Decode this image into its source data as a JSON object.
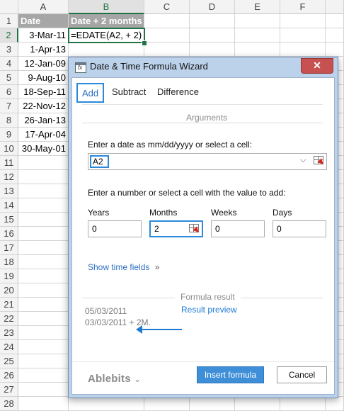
{
  "sheet": {
    "columns": [
      "A",
      "B",
      "C",
      "D",
      "E",
      "F"
    ],
    "rows": [
      "1",
      "2",
      "3",
      "4",
      "5",
      "6",
      "7",
      "8",
      "9",
      "10",
      "11",
      "12",
      "13",
      "14",
      "15",
      "16",
      "17",
      "18",
      "19",
      "20",
      "21",
      "22",
      "23",
      "24",
      "25",
      "26",
      "27",
      "28"
    ],
    "header_a": "Date",
    "header_b": "Date + 2 months",
    "dates": [
      "3-Mar-11",
      "1-Apr-13",
      "12-Jan-09",
      "9-Aug-10",
      "18-Sep-11",
      "22-Nov-12",
      "26-Jan-13",
      "17-Apr-04",
      "30-May-01"
    ],
    "formula": "=EDATE(A2, + 2)"
  },
  "dialog": {
    "title": "Date & Time Formula Wizard",
    "close_symbol": "✕",
    "tabs": [
      "Add",
      "Subtract",
      "Difference"
    ],
    "arguments_caption": "Arguments",
    "date_prompt": "Enter a date as mm/dd/yyyy or select a cell:",
    "date_value": "A2",
    "number_prompt": "Enter a number or select a cell with the value to add:",
    "years_label": "Years",
    "years_value": "0",
    "months_label": "Months",
    "months_value": "2",
    "weeks_label": "Weeks",
    "weeks_value": "0",
    "days_label": "Days",
    "days_value": "0",
    "show_time_fields": "Show time fields",
    "show_time_chevron": "»",
    "formula_result_caption": "Formula result",
    "result_line1": "05/03/2011",
    "result_line2": "03/03/2011 + 2M.",
    "annotation": "Result preview",
    "brand": "Ablebits",
    "brand_chevron": "⌄",
    "insert_label": "Insert formula",
    "cancel_label": "Cancel"
  }
}
